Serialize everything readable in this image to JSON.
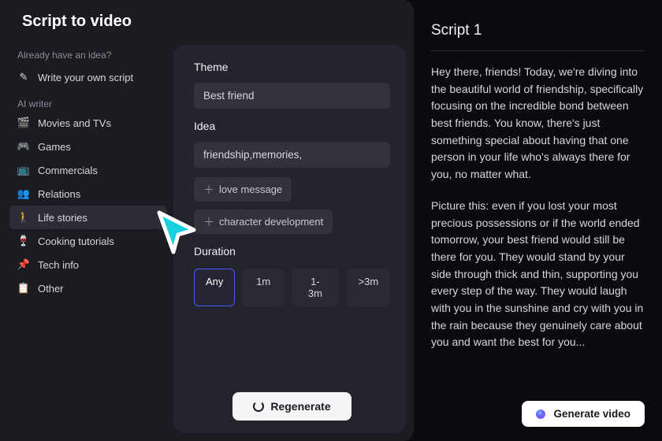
{
  "title": "Script to video",
  "sidebar": {
    "hint": "Already have an idea?",
    "write_own": "Write your own script",
    "group_label": "AI writer",
    "categories": [
      {
        "icon": "🎬",
        "label": "Movies and TVs"
      },
      {
        "icon": "🎮",
        "label": "Games"
      },
      {
        "icon": "📺",
        "label": "Commercials"
      },
      {
        "icon": "👥",
        "label": "Relations"
      },
      {
        "icon": "🚶",
        "label": "Life stories"
      },
      {
        "icon": "🍷",
        "label": "Cooking tutorials"
      },
      {
        "icon": "📌",
        "label": "Tech info"
      },
      {
        "icon": "📋",
        "label": "Other"
      }
    ],
    "selected_index": 4
  },
  "form": {
    "theme_label": "Theme",
    "theme_value": "Best friend",
    "idea_label": "Idea",
    "idea_value": "friendship,memories,",
    "suggestions": [
      "love message",
      "character development"
    ],
    "duration_label": "Duration",
    "durations": [
      "Any",
      "1m",
      "1-3m",
      ">3m"
    ],
    "duration_selected_index": 0,
    "regenerate": "Regenerate"
  },
  "script": {
    "title": "Script 1",
    "p1": "Hey there, friends! Today, we're diving into the beautiful world of friendship, specifically focusing on the incredible bond between best friends. You know, there's just something special about having that one person in your life who's always there for you, no matter what.",
    "p2": "Picture this: even if you lost your most precious possessions or if the world ended tomorrow, your best friend would still be there for you. They would stand by your side through thick and thin, supporting you every step of the way. They would laugh with you in the sunshine and cry with you in the rain because they genuinely care about you and want the best for you...",
    "generate": "Generate video"
  }
}
